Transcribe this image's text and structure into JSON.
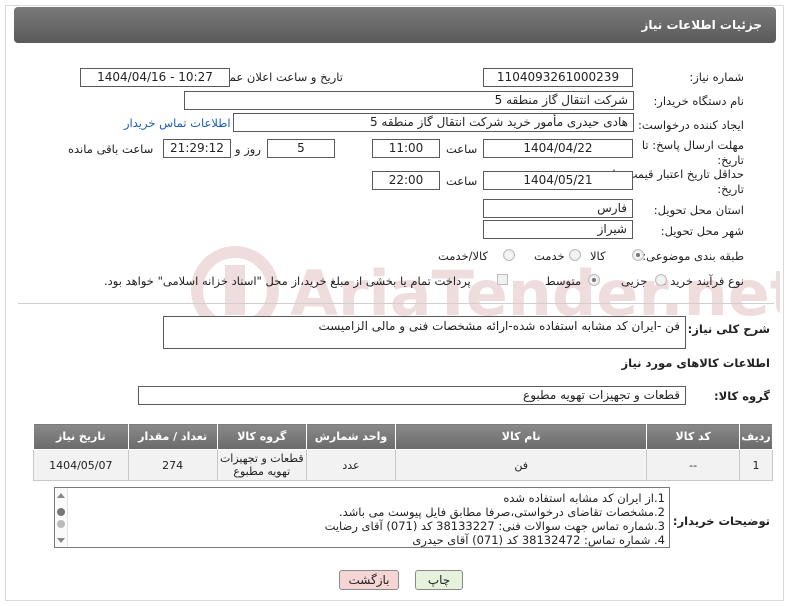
{
  "header": {
    "title": "جزئیات اطلاعات نیاز"
  },
  "fields": {
    "need_number_label": "شماره نیاز:",
    "need_number": "1104093261000239",
    "announce_label": "تاریخ و ساعت اعلان عمومی:",
    "announce_value": "1404/04/16 - 10:27",
    "buyer_org_label": "نام دستگاه خریدار:",
    "buyer_org": "شرکت انتقال گاز منطقه 5",
    "requester_label": "ایجاد کننده درخواست:",
    "requester": "هادی حیدری مأمور خرید شرکت انتقال گاز منطقه 5",
    "contact_link": "اطلاعات تماس خریدار",
    "deadline_label": "مهلت ارسال پاسخ: تا تاریخ:",
    "deadline_date": "1404/04/22",
    "hour_label": "ساعت",
    "deadline_time": "11:00",
    "days_value": "5",
    "days_label": "روز و",
    "remaining_time": "21:29:12",
    "remaining_label": "ساعت باقی مانده",
    "validity_label": "حداقل تاریخ اعتبار قیمت: تا تاریخ:",
    "validity_date": "1404/05/21",
    "validity_time": "22:00",
    "province_label": "استان محل تحویل:",
    "province": "فارس",
    "city_label": "شهر محل تحویل:",
    "city": "شیراز",
    "category_label": "طبقه بندی موضوعی:",
    "category_options": [
      "کالا",
      "خدمت",
      "کالا/خدمت"
    ],
    "process_label": "نوع فرآیند خرید :",
    "process_options": [
      "جزیی",
      "متوسط"
    ],
    "payment_note": "پرداخت تمام یا بخشی از مبلغ خرید،از محل \"اسناد خزانه اسلامی\" خواهد بود.",
    "description_label": "شرح کلی نیاز:",
    "description": "فن -ایران کد مشابه استفاده شده-ارائه مشخصات فنی و مالی الزامیست",
    "goods_section_title": "اطلاعات کالاهای مورد نیاز",
    "goods_group_label": "گروه کالا:",
    "goods_group": "قطعات و تجهیزات تهویه مطبوع"
  },
  "table": {
    "columns": [
      "ردیف",
      "کد کالا",
      "نام کالا",
      "واحد شمارش",
      "گروه کالا",
      "تعداد / مقدار",
      "تاریخ نیاز"
    ],
    "rows": [
      [
        "1",
        "--",
        "فن",
        "عدد",
        "قطعات و تجهیزات تهویه مطبوع",
        "274",
        "1404/05/07"
      ]
    ]
  },
  "buyer_notes": {
    "label": "توضیحات خریدار:",
    "lines": [
      "1.از ایران کد مشابه استفاده شده",
      "2.مشخصات تقاضای درخواستی،صرفا مطابق فایل پیوست می باشد.",
      "3.شماره تماس جهت سوالات فنی: 38133227 کد (071) آقای رضایت",
      "4. شماره تماس:  38132472 کد (071) آقای حیدری"
    ]
  },
  "buttons": {
    "print": "چاپ",
    "back": "بازگشت"
  },
  "watermark": {
    "text": "AriaTender.net"
  },
  "colors": {
    "header_bg": "#6b6b6b",
    "link": "#1a5fb4",
    "back_btn": "#f6d5d5",
    "print_btn": "#e6f2dc"
  }
}
